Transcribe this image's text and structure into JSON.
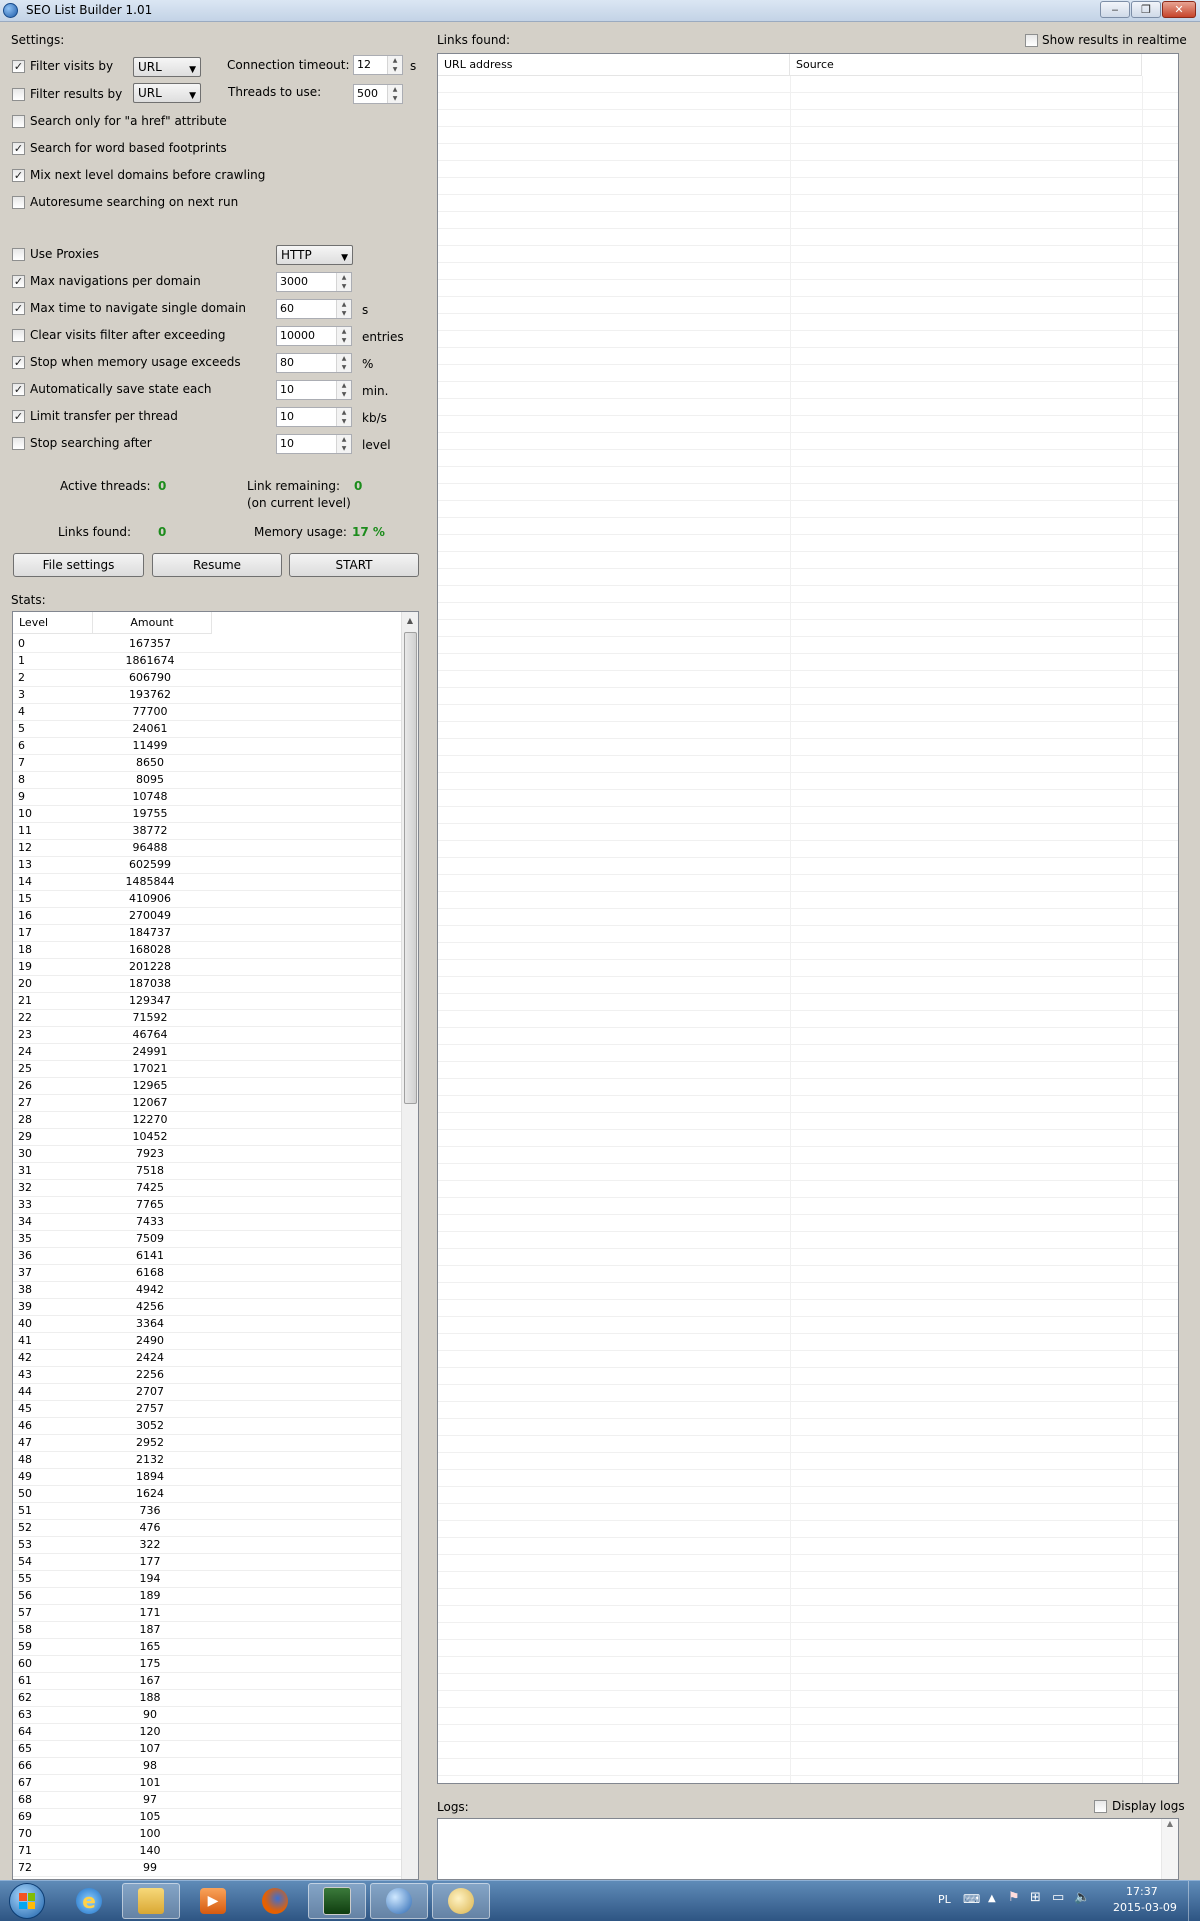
{
  "window": {
    "title": "SEO List Builder 1.01"
  },
  "settings": {
    "section_label": "Settings:",
    "filter_visits": {
      "label": "Filter visits by",
      "checked": true,
      "value": "URL"
    },
    "filter_results": {
      "label": "Filter results by",
      "checked": false,
      "value": "URL"
    },
    "connection_timeout": {
      "label": "Connection timeout:",
      "value": "12",
      "unit": "s"
    },
    "threads": {
      "label": "Threads to use:",
      "value": "500"
    },
    "search_href": {
      "label": "Search only for \"a href\" attribute",
      "checked": false
    },
    "search_word": {
      "label": "Search for word based footprints",
      "checked": true
    },
    "mix_domains": {
      "label": "Mix next level domains before crawling",
      "checked": true
    },
    "autoresume": {
      "label": "Autoresume searching on next run",
      "checked": false
    },
    "use_proxies": {
      "label": "Use Proxies",
      "checked": false,
      "value": "HTTP"
    },
    "max_nav": {
      "label": "Max navigations per domain",
      "checked": true,
      "value": "3000",
      "unit": ""
    },
    "max_time": {
      "label": "Max time to navigate single domain",
      "checked": true,
      "value": "60",
      "unit": "s"
    },
    "clear_visits": {
      "label": "Clear visits filter after exceeding",
      "checked": false,
      "value": "10000",
      "unit": "entries"
    },
    "stop_memory": {
      "label": "Stop when memory usage exceeds",
      "checked": true,
      "value": "80",
      "unit": "%"
    },
    "auto_save": {
      "label": "Automatically save state each",
      "checked": true,
      "value": "10",
      "unit": "min."
    },
    "limit_transfer": {
      "label": "Limit transfer per thread",
      "checked": true,
      "value": "10",
      "unit": "kb/s"
    },
    "stop_after": {
      "label": "Stop searching after",
      "checked": false,
      "value": "10",
      "unit": "level"
    }
  },
  "status": {
    "active_threads_label": "Active threads:",
    "active_threads": "0",
    "link_remaining_label": "Link remaining:",
    "link_remaining_sub": "(on current level)",
    "link_remaining": "0",
    "links_found_label": "Links found:",
    "links_found": "0",
    "memory_label": "Memory usage:",
    "memory": "17 %"
  },
  "buttons": {
    "file_settings": "File settings",
    "resume": "Resume",
    "start": "START"
  },
  "stats": {
    "label": "Stats:",
    "columns": [
      "Level",
      "Amount"
    ],
    "rows": [
      [
        "0",
        "167357"
      ],
      [
        "1",
        "1861674"
      ],
      [
        "2",
        "606790"
      ],
      [
        "3",
        "193762"
      ],
      [
        "4",
        "77700"
      ],
      [
        "5",
        "24061"
      ],
      [
        "6",
        "11499"
      ],
      [
        "7",
        "8650"
      ],
      [
        "8",
        "8095"
      ],
      [
        "9",
        "10748"
      ],
      [
        "10",
        "19755"
      ],
      [
        "11",
        "38772"
      ],
      [
        "12",
        "96488"
      ],
      [
        "13",
        "602599"
      ],
      [
        "14",
        "1485844"
      ],
      [
        "15",
        "410906"
      ],
      [
        "16",
        "270049"
      ],
      [
        "17",
        "184737"
      ],
      [
        "18",
        "168028"
      ],
      [
        "19",
        "201228"
      ],
      [
        "20",
        "187038"
      ],
      [
        "21",
        "129347"
      ],
      [
        "22",
        "71592"
      ],
      [
        "23",
        "46764"
      ],
      [
        "24",
        "24991"
      ],
      [
        "25",
        "17021"
      ],
      [
        "26",
        "12965"
      ],
      [
        "27",
        "12067"
      ],
      [
        "28",
        "12270"
      ],
      [
        "29",
        "10452"
      ],
      [
        "30",
        "7923"
      ],
      [
        "31",
        "7518"
      ],
      [
        "32",
        "7425"
      ],
      [
        "33",
        "7765"
      ],
      [
        "34",
        "7433"
      ],
      [
        "35",
        "7509"
      ],
      [
        "36",
        "6141"
      ],
      [
        "37",
        "6168"
      ],
      [
        "38",
        "4942"
      ],
      [
        "39",
        "4256"
      ],
      [
        "40",
        "3364"
      ],
      [
        "41",
        "2490"
      ],
      [
        "42",
        "2424"
      ],
      [
        "43",
        "2256"
      ],
      [
        "44",
        "2707"
      ],
      [
        "45",
        "2757"
      ],
      [
        "46",
        "3052"
      ],
      [
        "47",
        "2952"
      ],
      [
        "48",
        "2132"
      ],
      [
        "49",
        "1894"
      ],
      [
        "50",
        "1624"
      ],
      [
        "51",
        "736"
      ],
      [
        "52",
        "476"
      ],
      [
        "53",
        "322"
      ],
      [
        "54",
        "177"
      ],
      [
        "55",
        "194"
      ],
      [
        "56",
        "189"
      ],
      [
        "57",
        "171"
      ],
      [
        "58",
        "187"
      ],
      [
        "59",
        "165"
      ],
      [
        "60",
        "175"
      ],
      [
        "61",
        "167"
      ],
      [
        "62",
        "188"
      ],
      [
        "63",
        "90"
      ],
      [
        "64",
        "120"
      ],
      [
        "65",
        "107"
      ],
      [
        "66",
        "98"
      ],
      [
        "67",
        "101"
      ],
      [
        "68",
        "97"
      ],
      [
        "69",
        "105"
      ],
      [
        "70",
        "100"
      ],
      [
        "71",
        "140"
      ],
      [
        "72",
        "99"
      ]
    ]
  },
  "links": {
    "label": "Links found:",
    "realtime_label": "Show results in realtime",
    "realtime_checked": false,
    "columns": [
      "URL address",
      "Source"
    ]
  },
  "logs": {
    "label": "Logs:",
    "display_label": "Display logs",
    "display_checked": false
  },
  "taskbar": {
    "language": "PL",
    "time": "17:37",
    "date": "2015-03-09",
    "apps": [
      "internet-explorer-icon",
      "file-explorer-icon",
      "media-player-icon",
      "firefox-icon",
      "task-manager-icon",
      "seo-list-builder-icon",
      "paint-icon"
    ]
  },
  "colors": {
    "accent_green": "#1c8c1c",
    "taskbar": "#2e5583",
    "panel_bg": "#d4d0c8"
  }
}
